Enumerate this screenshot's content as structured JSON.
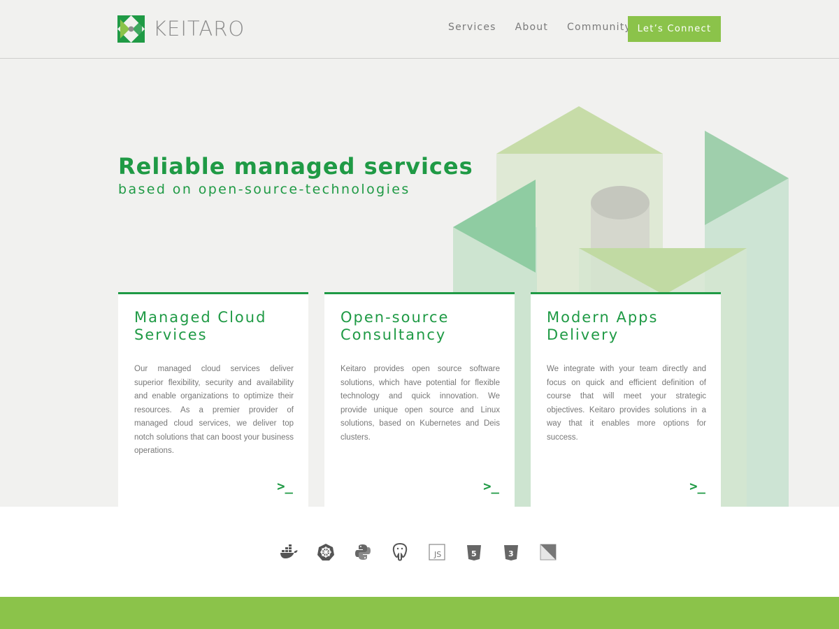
{
  "brand": {
    "name": "KEITARO"
  },
  "nav": {
    "items": [
      {
        "label": "Services"
      },
      {
        "label": "About"
      },
      {
        "label": "Community"
      }
    ],
    "cta_label": "Let’s Connect"
  },
  "hero": {
    "title": "Reliable managed services",
    "subtitle": "based on open-source-technologies"
  },
  "cards": [
    {
      "title": "Managed Cloud Services",
      "body": "Our managed cloud services deliver superior flexibility, security and availability and enable organizations to optimize their resources. As a premier provider of managed cloud services, we deliver top notch solutions that can boost your business operations.",
      "prompt": ">_"
    },
    {
      "title": "Open-source Consultancy",
      "body": "Keitaro provides open source software solutions, which have potential for flexible technology and quick innovation. We provide unique open source and Linux solutions, based on Kubernetes and Deis clusters.",
      "prompt": ">_"
    },
    {
      "title": "Modern Apps Delivery",
      "body": "We integrate with your team directly and focus on quick and efficient definition of course that will meet your strategic objectives. Keitaro provides solutions in a way that it enables more options for success.",
      "prompt": ">_"
    }
  ],
  "tech_icons": [
    {
      "icon": "docker-icon"
    },
    {
      "icon": "kubernetes-icon"
    },
    {
      "icon": "python-icon"
    },
    {
      "icon": "postgresql-icon"
    },
    {
      "icon": "javascript-icon",
      "text": "JS"
    },
    {
      "icon": "html5-icon",
      "text": "5"
    },
    {
      "icon": "css3-icon",
      "text": "3"
    },
    {
      "icon": "extjs-icon"
    }
  ],
  "colors": {
    "brand_green": "#1f9a45",
    "accent_green": "#8bc34a",
    "background": "#f1f1ef"
  }
}
